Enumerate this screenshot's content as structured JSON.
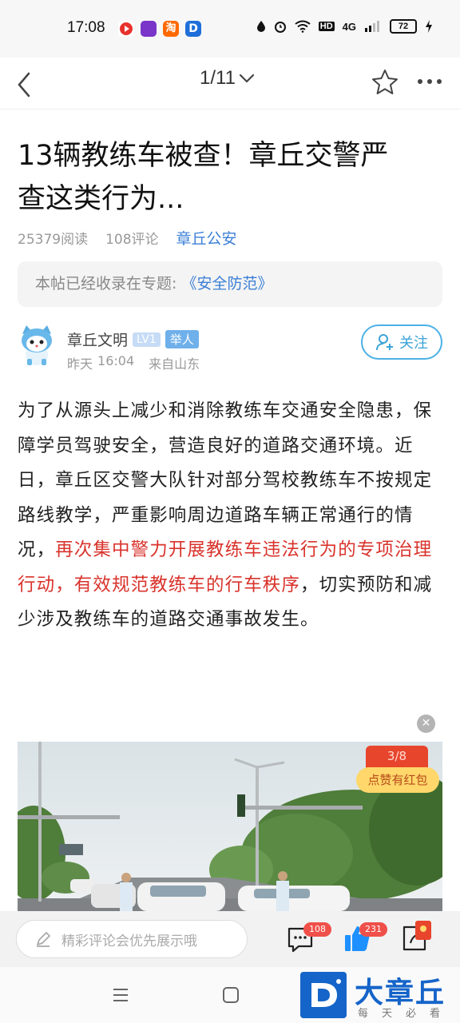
{
  "status_bar": {
    "time": "17:08",
    "network_label": "HD",
    "signal_label": "4G",
    "battery": "72"
  },
  "nav": {
    "page_indicator": "1/11"
  },
  "article": {
    "title_line1": "13辆教练车被查！章丘交警严",
    "title_line2": "查这类行为...",
    "reads": "25379阅读",
    "comments": "108评论",
    "source": "章丘公安",
    "topic_prefix": "本帖已经收录在专题:",
    "topic_link": "《安全防范》",
    "author": {
      "name": "章丘文明",
      "level": "LV1",
      "report": "举人",
      "date": "昨天",
      "time": "16:04",
      "location": "来自山东",
      "follow_label": "关注"
    },
    "body_part1": "为了从源头上减少和消除教练车交通安全隐患，保障学员驾驶安全，营造良好的道路交通环境。近日，章丘区交警大队针对部分驾校教练车不按规定路线教学，严重影响周边道路车辆正常通行的情况，",
    "body_highlight": "再次集中警力开展教练车违法行为的专项治理行动，有效规范教练车的行车秩序",
    "body_part2": "，切实预防和减少涉及教练车的道路交通事故发生。"
  },
  "red_packet": {
    "count": "3/8",
    "label": "点赞有红包"
  },
  "bottom_bar": {
    "comment_placeholder": "精彩评论会优先展示哦",
    "comment_count": "108",
    "like_count": "231"
  },
  "logo": {
    "text": "大章丘",
    "subtitle": "每天必看"
  },
  "colors": {
    "accent": "#3b7fd6",
    "highlight": "#d9332c",
    "follow": "#4bb1e6",
    "badge": "#f0504a"
  }
}
